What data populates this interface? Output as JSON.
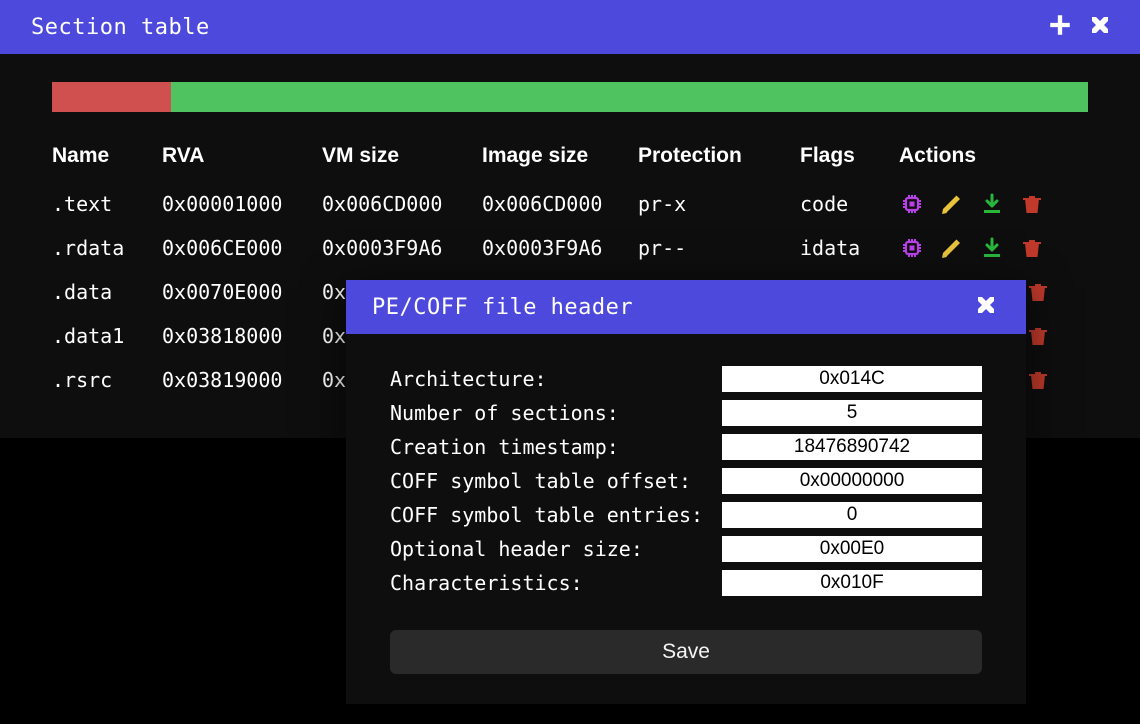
{
  "section_window": {
    "title": "Section table",
    "segments": [
      {
        "color": "#d05050",
        "width_pct": 11.5
      },
      {
        "color": "#4ec360",
        "width_pct": 88.5
      }
    ],
    "columns": [
      "Name",
      "RVA",
      "VM size",
      "Image size",
      "Protection",
      "Flags",
      "Actions"
    ],
    "rows": [
      {
        "name": ".text",
        "rva": "0x00001000",
        "vm": "0x006CD000",
        "img": "0x006CD000",
        "prot": "pr-x",
        "flags": "code"
      },
      {
        "name": ".rdata",
        "rva": "0x006CE000",
        "vm": "0x0003F9A6",
        "img": "0x0003F9A6",
        "prot": "pr--",
        "flags": "idata"
      },
      {
        "name": ".data",
        "rva": "0x0070E000",
        "vm": "0x",
        "img": "",
        "prot": "",
        "flags": ""
      },
      {
        "name": ".data1",
        "rva": "0x03818000",
        "vm": "0x",
        "img": "",
        "prot": "",
        "flags": ""
      },
      {
        "name": ".rsrc",
        "rva": "0x03819000",
        "vm": "0x",
        "img": "",
        "prot": "",
        "flags": ""
      }
    ]
  },
  "modal": {
    "title": "PE/COFF file header",
    "fields": [
      {
        "label": "Architecture:",
        "value": "0x014C"
      },
      {
        "label": "Number of sections:",
        "value": "5"
      },
      {
        "label": "Creation timestamp:",
        "value": "18476890742"
      },
      {
        "label": "COFF symbol table offset:",
        "value": "0x00000000"
      },
      {
        "label": "COFF symbol table entries:",
        "value": "0"
      },
      {
        "label": "Optional header size:",
        "value": "0x00E0"
      },
      {
        "label": "Characteristics:",
        "value": "0x010F"
      }
    ],
    "save_label": "Save"
  },
  "icons": {
    "chip_color": "#b940e8",
    "pencil_color": "#e8c33c",
    "download_color": "#29b73a",
    "trash_color": "#c0392b"
  }
}
